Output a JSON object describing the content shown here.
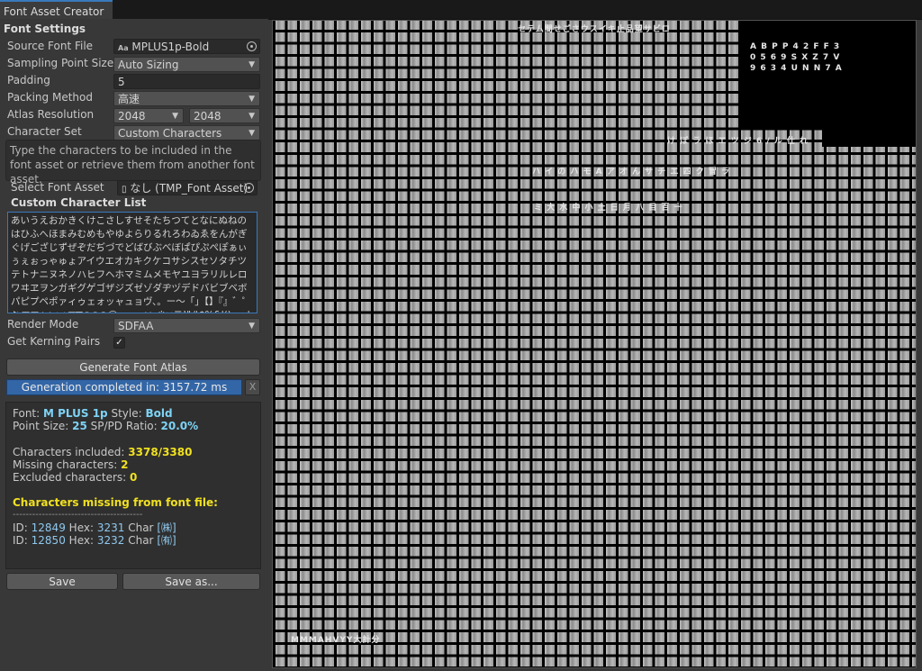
{
  "window": {
    "tab_title": "Font Asset Creator"
  },
  "settings": {
    "section_title": "Font Settings",
    "source_font_label": "Source Font File",
    "source_font_value": "MPLUS1p-Bold",
    "source_font_icon": "Aa",
    "sampling_label": "Sampling Point Size",
    "sampling_value": "Auto Sizing",
    "padding_label": "Padding",
    "padding_value": "5",
    "packing_label": "Packing Method",
    "packing_value": "高速",
    "atlas_label": "Atlas Resolution",
    "atlas_width": "2048",
    "atlas_height": "2048",
    "charset_label": "Character Set",
    "charset_value": "Custom Characters",
    "help_text": "Type the characters to be included in the font asset or retrieve them from another font asset.",
    "select_font_asset_label": "Select Font Asset",
    "select_font_asset_value": "なし (TMP_Font Asset)",
    "custom_list_title": "Custom Character List",
    "custom_list_text": "あいうえおかきくけこさしすせそたちつてとなにぬねのはひふへほまみむめもやゆよらりるれろわゐゑをんがぎぐげござじずぜぞだぢづでどばびぶべぼぱぴぷぺぽぁぃぅぇぉっゃゅょアイウエオカキクケコサシスセソタチツテトナニヌネノハヒフヘホマミムメモヤユヨラリルレロワヰヱヲンガギグゲゴザジズゼゾダヂヅデドバビブベボパピプペポァィゥェォッャュョヴ、。ー〜「」【】『』゛゜♪♭■□◆◇△▲▽▼◎○●◯・…‥：；※×〒!\"#$%&'()=~|`{+*}<>?_-^¥@[:;]./¥!\"#$%&'()=~|`{+*",
    "render_mode_label": "Render Mode",
    "render_mode_value": "SDFAA",
    "kerning_label": "Get Kerning Pairs",
    "kerning_checked": "✓",
    "generate_button": "Generate Font Atlas",
    "progress_text": "Generation completed in: 3157.72 ms",
    "progress_fraction": 1.0,
    "cancel_label": "X"
  },
  "report": {
    "font_label": "Font:",
    "font_value": "M PLUS 1p",
    "style_label": "Style:",
    "style_value": "Bold",
    "point_size_label": "Point Size:",
    "point_size_value": "25",
    "ratio_label": "SP/PD Ratio:",
    "ratio_value": "20.0%",
    "included_label": "Characters included:",
    "included_value": "3378/3380",
    "missing_label": "Missing characters:",
    "missing_value": "2",
    "excluded_label": "Excluded characters:",
    "excluded_value": "0",
    "missing_title": "Characters missing from font file:",
    "divider": "----------------------------------------",
    "missing_rows": [
      {
        "id_label": "ID:",
        "id": "12849",
        "hex_label": "Hex:",
        "hex": "3231",
        "char_label": "Char",
        "char": "[㈱]"
      },
      {
        "id_label": "ID:",
        "id": "12850",
        "hex_label": "Hex:",
        "hex": "3232",
        "char_label": "Char",
        "char": "[㈲]"
      }
    ]
  },
  "buttons": {
    "save": "Save",
    "save_as": "Save as..."
  },
  "atlas_preview": {
    "glyph_rows": [
      "セテム間せごさウスイキ止品望サビロ",
      "A B P P 4 2 F F 3",
      "0 5 6 9 S X Z 7 V",
      "9 6 3 4 U N N 7 A",
      "け ぼ ラ ほ エ ツ ジ 6 / ル 仕 れ",
      "ハ イ の ハ モ A ア オ ん サ チ エ 四 ク 冒 ラ",
      "ミ 大 水 中 小 土 日 月 八 目 百 十",
      "MMMAHVYY大計分"
    ]
  }
}
